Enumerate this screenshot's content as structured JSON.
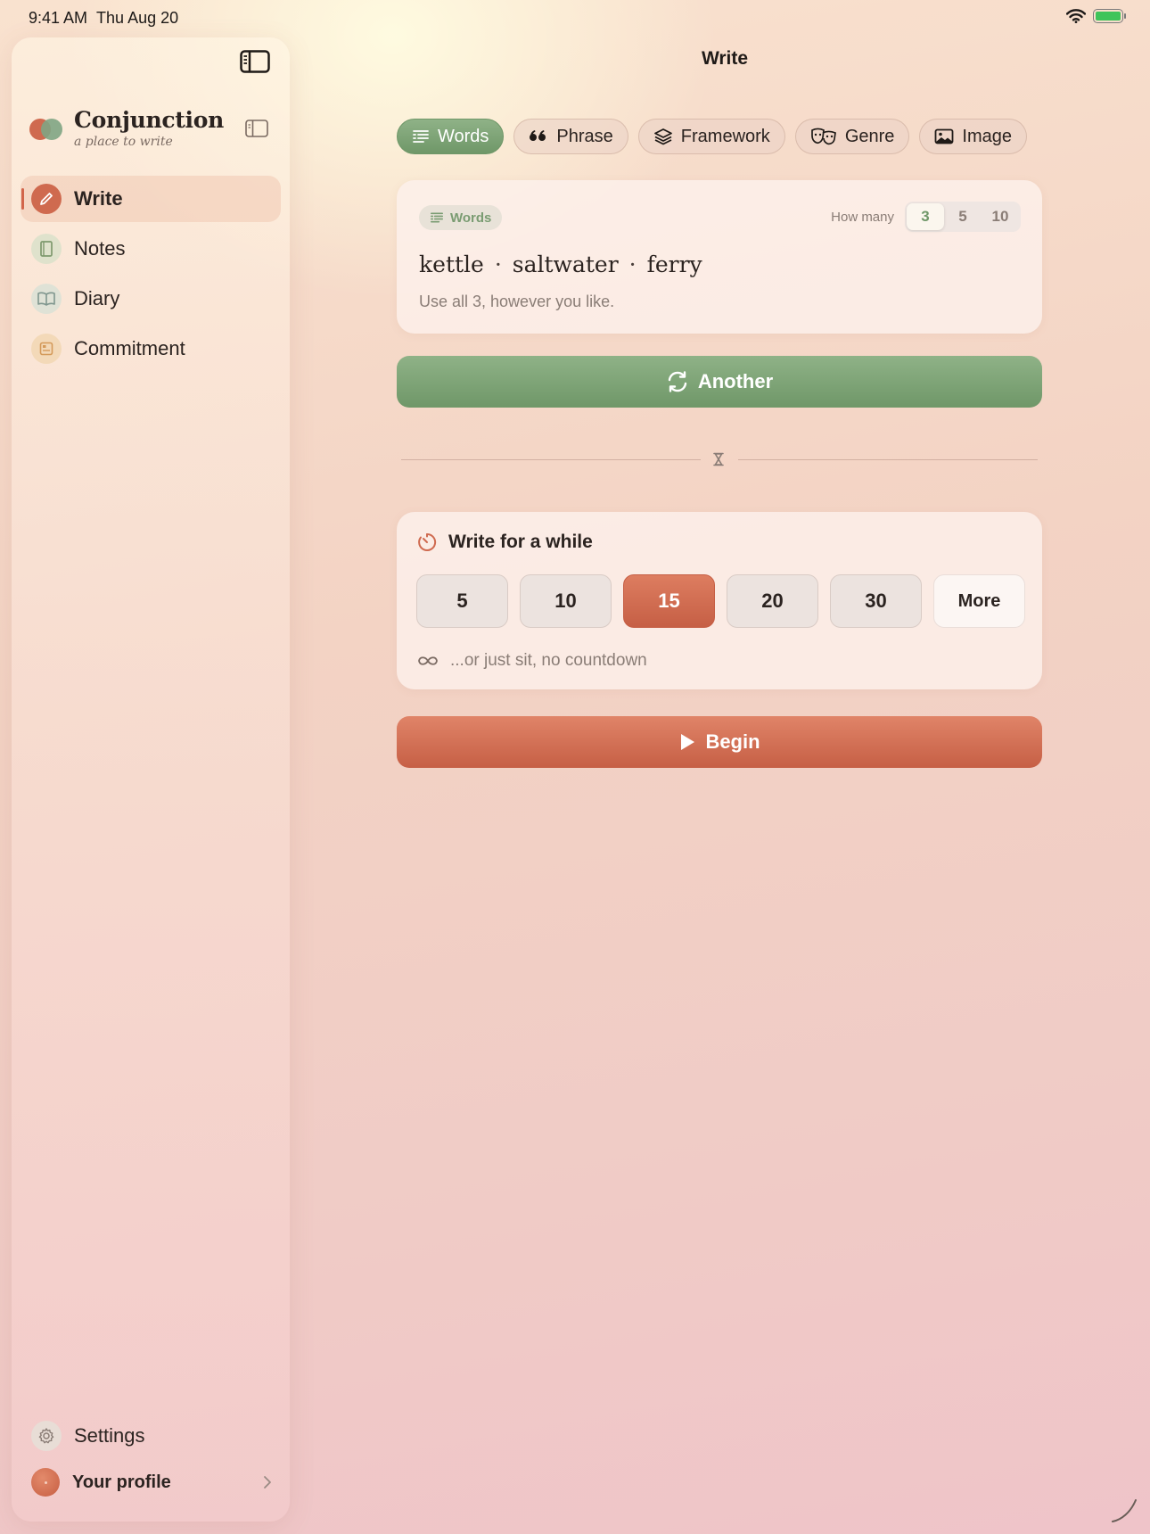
{
  "status": {
    "time": "9:41 AM",
    "date": "Thu Aug 20"
  },
  "header": {
    "title": "Write"
  },
  "brand": {
    "name": "Conjunction",
    "tagline": "a place to write"
  },
  "sidebar": {
    "items": [
      {
        "label": "Write",
        "icon": "pencil-icon",
        "active": true
      },
      {
        "label": "Notes",
        "icon": "notebook-icon",
        "active": false
      },
      {
        "label": "Diary",
        "icon": "open-book-icon",
        "active": false
      },
      {
        "label": "Commitment",
        "icon": "card-icon",
        "active": false
      }
    ],
    "settings_label": "Settings",
    "profile_label": "Your profile"
  },
  "tabs": [
    {
      "label": "Words",
      "icon": "list-icon",
      "active": true
    },
    {
      "label": "Phrase",
      "icon": "quote-icon",
      "active": false
    },
    {
      "label": "Framework",
      "icon": "layers-icon",
      "active": false
    },
    {
      "label": "Genre",
      "icon": "theater-masks-icon",
      "active": false
    },
    {
      "label": "Image",
      "icon": "image-icon",
      "active": false
    }
  ],
  "prompt": {
    "badge": "Words",
    "how_many_label": "How many",
    "counts": [
      "3",
      "5",
      "10"
    ],
    "selected_count": "3",
    "words": [
      "kettle",
      "saltwater",
      "ferry"
    ],
    "separator": "·",
    "hint": "Use all 3, however you like."
  },
  "another_label": "Another",
  "timer": {
    "title": "Write for a while",
    "durations": [
      "5",
      "10",
      "15",
      "20",
      "30"
    ],
    "selected": "15",
    "more_label": "More",
    "no_countdown": "...or just sit, no countdown"
  },
  "begin_label": "Begin",
  "colors": {
    "accent_green": "#6f9768",
    "accent_terracotta": "#c65f45",
    "text_primary": "#2b2320",
    "text_muted": "#8a7d76"
  }
}
